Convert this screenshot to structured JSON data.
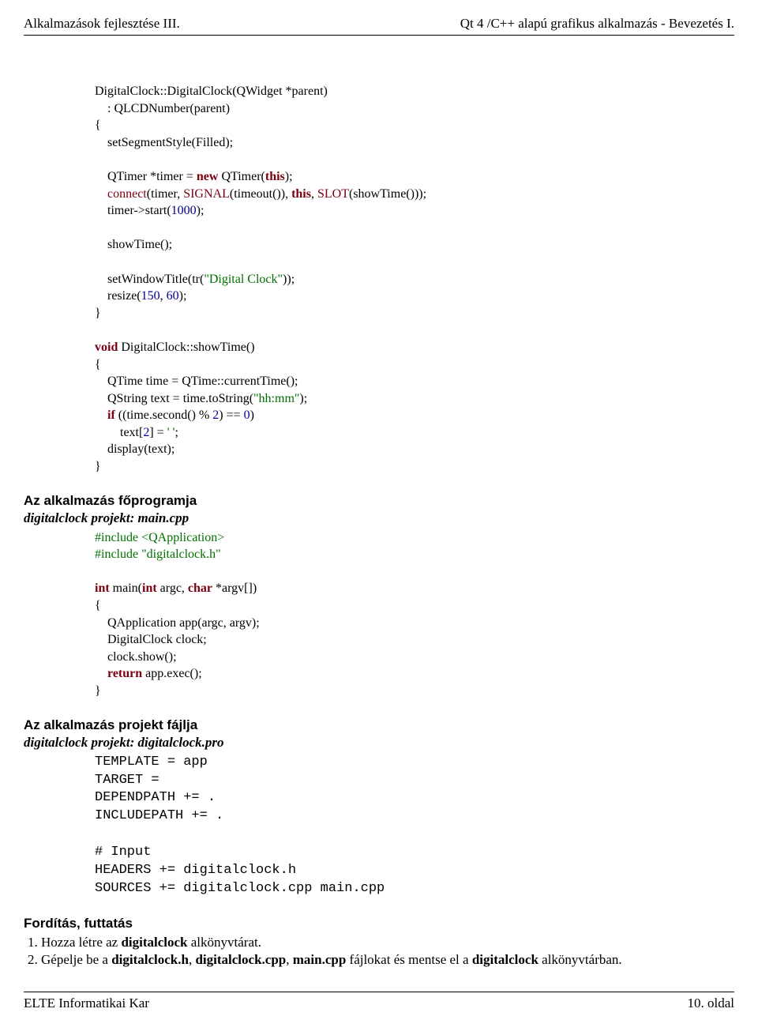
{
  "header": {
    "left": "Alkalmazások fejlesztése III.",
    "right": "Qt 4 /C++ alapú grafikus alkalmazás - Bevezetés I."
  },
  "footer": {
    "left": "ELTE Informatikai Kar",
    "right": "10. oldal"
  },
  "sections": {
    "mainprogram_title": "Az alkalmazás főprogramja",
    "mainprogram_sub": "digitalclock  projekt: main.cpp",
    "projectfile_title": "Az alkalmazás projekt fájlja",
    "projectfile_sub": "digitalclock  projekt: digitalclock.pro",
    "compile_title": "Fordítás, futtatás"
  },
  "code_cpp_impl": {
    "l01a": "DigitalClock::DigitalClock(QWidget *parent)",
    "l02a": "    : QLCDNumber(parent)",
    "l03a": "{",
    "l04a": "    setSegmentStyle(Filled);",
    "l05a": "",
    "l06_prefix": "    QTimer *timer = ",
    "l06_kw": "new",
    "l06_mid": " QTimer(",
    "l06_kw2": "this",
    "l06_end": ");",
    "l07_indent": "    ",
    "l07_connect": "connect",
    "l07_a": "(timer, ",
    "l07_signal": "SIGNAL",
    "l07_b": "(timeout()), ",
    "l07_kwthis": "this",
    "l07_c": ", ",
    "l07_slot": "SLOT",
    "l07_d": "(showTime()));",
    "l08_a": "    timer->start(",
    "l08_num": "1000",
    "l08_b": ");",
    "l09a": "",
    "l10a": "    showTime();",
    "l11a": "",
    "l12_a": "    setWindowTitle(tr(",
    "l12_str": "\"Digital Clock\"",
    "l12_b": "));",
    "l13_a": "    resize(",
    "l13_n1": "150",
    "l13_c": ", ",
    "l13_n2": "60",
    "l13_b": ");",
    "l14a": "}",
    "l15a": "",
    "l16_kwvoid": "void",
    "l16_rest": " DigitalClock::showTime()",
    "l17a": "{",
    "l18a": "    QTime time = QTime::currentTime();",
    "l19_a": "    QString text = time.toString(",
    "l19_str": "\"hh:mm\"",
    "l19_b": ");",
    "l20_a": "    ",
    "l20_kw": "if",
    "l20_b": " ((time.second() % ",
    "l20_n1": "2",
    "l20_c": ") == ",
    "l20_n2": "0",
    "l20_d": ")",
    "l21_a": "        text[",
    "l21_n": "2",
    "l21_b": "] = ",
    "l21_str": "' '",
    "l21_c": ";",
    "l22a": "    display(text);",
    "l23a": "}"
  },
  "code_main": {
    "l01": "#include <QApplication>",
    "l02": "#include \"digitalclock.h\"",
    "l03": "",
    "l04_kw1": "int",
    "l04_a": " main(",
    "l04_kw2": "int",
    "l04_b": " argc, ",
    "l04_kw3": "char",
    "l04_c": " *argv[])",
    "l05": "{",
    "l06": "    QApplication app(argc, argv);",
    "l07": "    DigitalClock clock;",
    "l08": "    clock.show();",
    "l09_a": "    ",
    "l09_kw": "return",
    "l09_b": " app.exec();",
    "l10": "}"
  },
  "code_pro": {
    "l01": "TEMPLATE = app",
    "l02": "TARGET = ",
    "l03": "DEPENDPATH += .",
    "l04": "INCLUDEPATH += .",
    "l05": "",
    "l06": "# Input",
    "l07": "HEADERS += digitalclock.h",
    "l08": "SOURCES += digitalclock.cpp main.cpp"
  },
  "steps": {
    "s1_a": "Hozza létre az ",
    "s1_b": "digitalclock",
    "s1_c": " alkönyvtárat.",
    "s2_a": "Gépelje be a ",
    "s2_b": "digitalclock.h",
    "s2_c": ", ",
    "s2_d": "digitalclock.cpp",
    "s2_e": ", ",
    "s2_f": "main.cpp",
    "s2_g": " fájlokat és mentse el a ",
    "s2_h": "digitalclock",
    "s2_i": " alkönyvtárban."
  }
}
